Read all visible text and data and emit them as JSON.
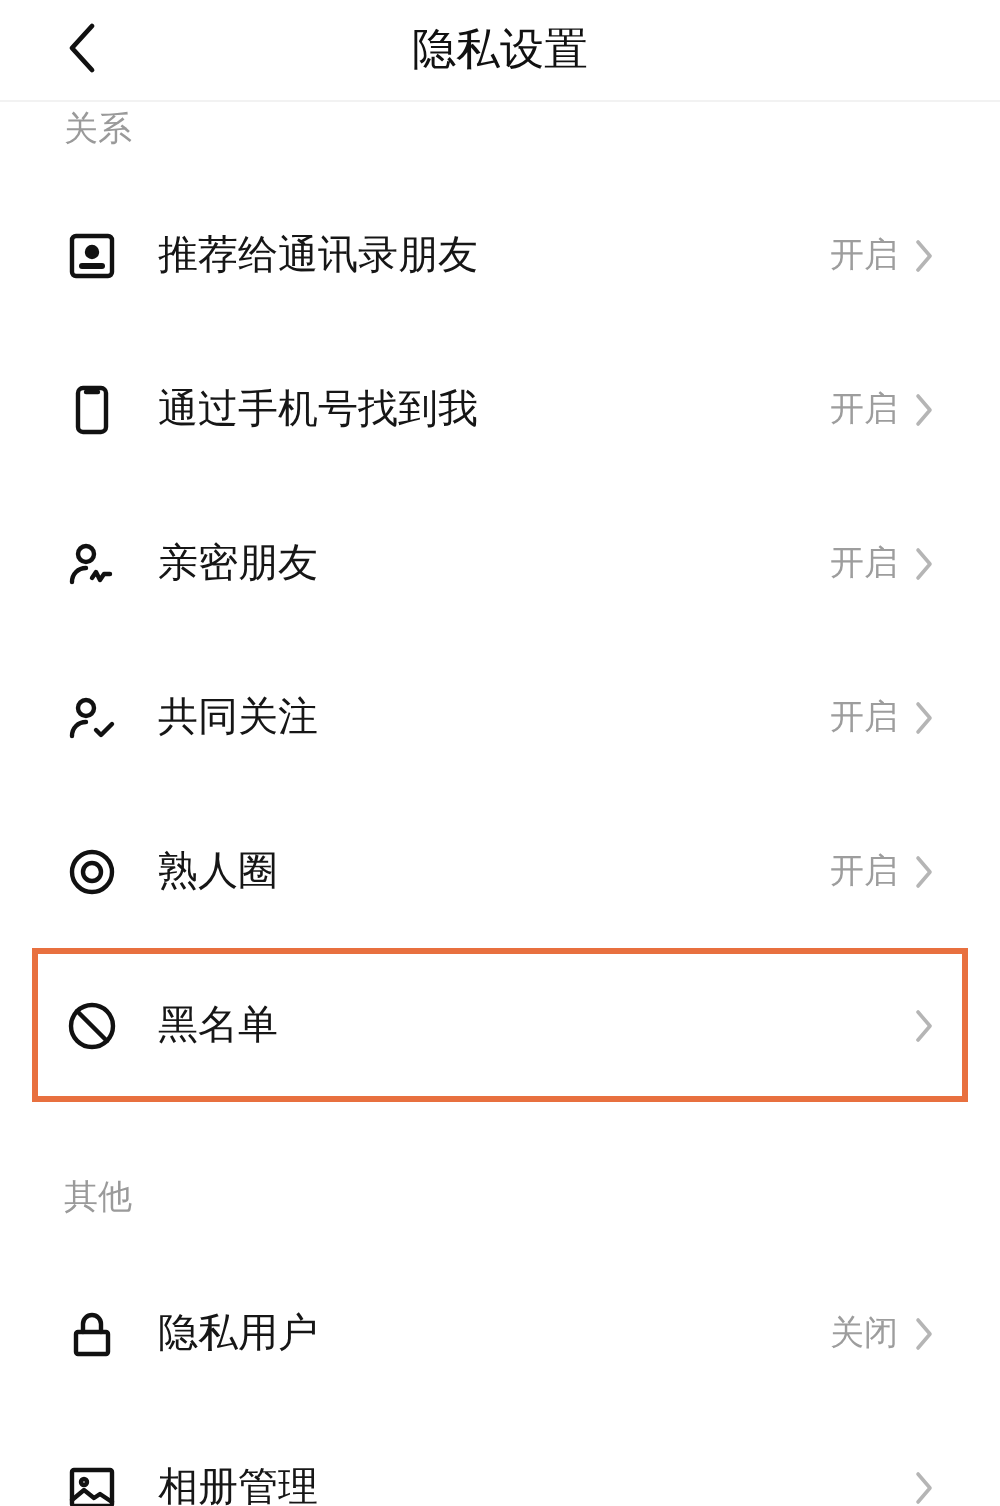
{
  "header": {
    "title": "隐私设置"
  },
  "sections": [
    {
      "label": "关系",
      "rows": [
        {
          "label": "推荐给通讯录朋友",
          "value": "开启",
          "highlighted": false
        },
        {
          "label": "通过手机号找到我",
          "value": "开启",
          "highlighted": false
        },
        {
          "label": "亲密朋友",
          "value": "开启",
          "highlighted": false
        },
        {
          "label": "共同关注",
          "value": "开启",
          "highlighted": false
        },
        {
          "label": "熟人圈",
          "value": "开启",
          "highlighted": false
        },
        {
          "label": "黑名单",
          "highlighted": true
        }
      ]
    },
    {
      "label": "其他",
      "rows": [
        {
          "label": "隐私用户",
          "value": "关闭",
          "highlighted": false
        },
        {
          "label": "相册管理",
          "highlighted": false
        }
      ]
    }
  ]
}
